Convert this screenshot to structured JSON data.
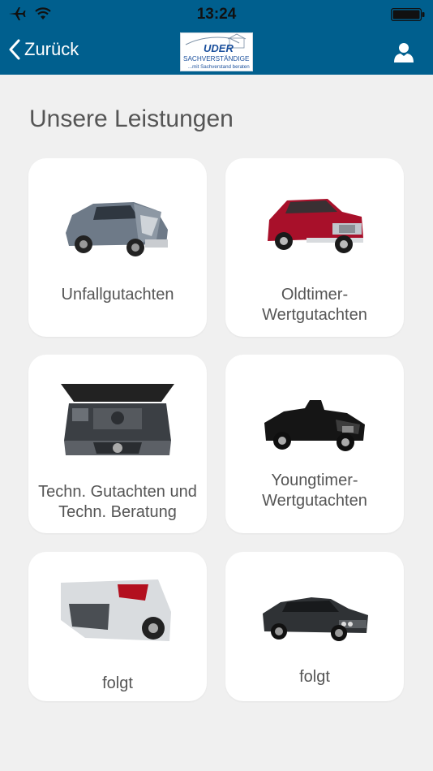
{
  "status_bar": {
    "time": "13:24",
    "icons": [
      "airplane-icon",
      "wifi-icon",
      "battery-icon"
    ]
  },
  "nav": {
    "back_label": "Zurück",
    "logo": {
      "brand": "UDER",
      "line1": "SACHVERSTÄNDIGE",
      "tagline": "...mit Sachverstand beraten"
    },
    "profile_icon": "user-icon"
  },
  "main": {
    "title": "Unsere Leistungen",
    "cards": [
      {
        "label": "Unfallgutachten",
        "image": "damaged-car-photo"
      },
      {
        "label": "Oldtimer-\nWertgutachten",
        "image": "red-classic-mercedes-photo"
      },
      {
        "label": "Techn. Gutachten und\nTechn. Beratung",
        "image": "engine-bay-photo"
      },
      {
        "label": "Youngtimer-\nWertgutachten",
        "image": "black-convertible-photo"
      },
      {
        "label": "folgt",
        "image": "crashed-rear-photo"
      },
      {
        "label": "folgt",
        "image": "bmw-coupe-photo"
      }
    ]
  },
  "colors": {
    "header_bg": "#005f8e",
    "page_bg": "#f0f0f0",
    "card_bg": "#ffffff",
    "text": "#555555"
  }
}
